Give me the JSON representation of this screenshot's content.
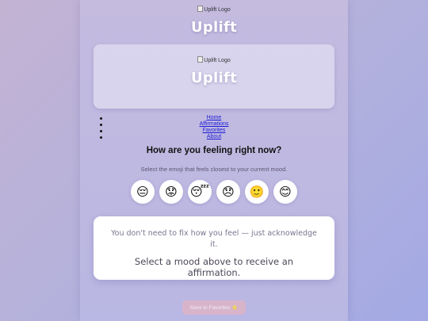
{
  "header": {
    "logo_alt": "Uplift Logo",
    "title": "Uplift"
  },
  "hero": {
    "logo_alt": "Uplift Logo",
    "title": "Uplift"
  },
  "nav": {
    "items": [
      "Home",
      "Affirmations",
      "Favorites",
      "About"
    ]
  },
  "mood_section": {
    "question": "How are you feeling right now?",
    "instruction": "Select the emoji that feels closest to your current mood.",
    "moods": [
      "😔",
      "😟",
      "😴",
      "😞",
      "🙂",
      "😊"
    ]
  },
  "affirmation_card": {
    "subtext": "You don't need to fix how you feel — just acknowledge it.",
    "message": "Select a mood above to receive an affirmation."
  },
  "actions": {
    "save_label": "Save to Favorites ⭐"
  }
}
